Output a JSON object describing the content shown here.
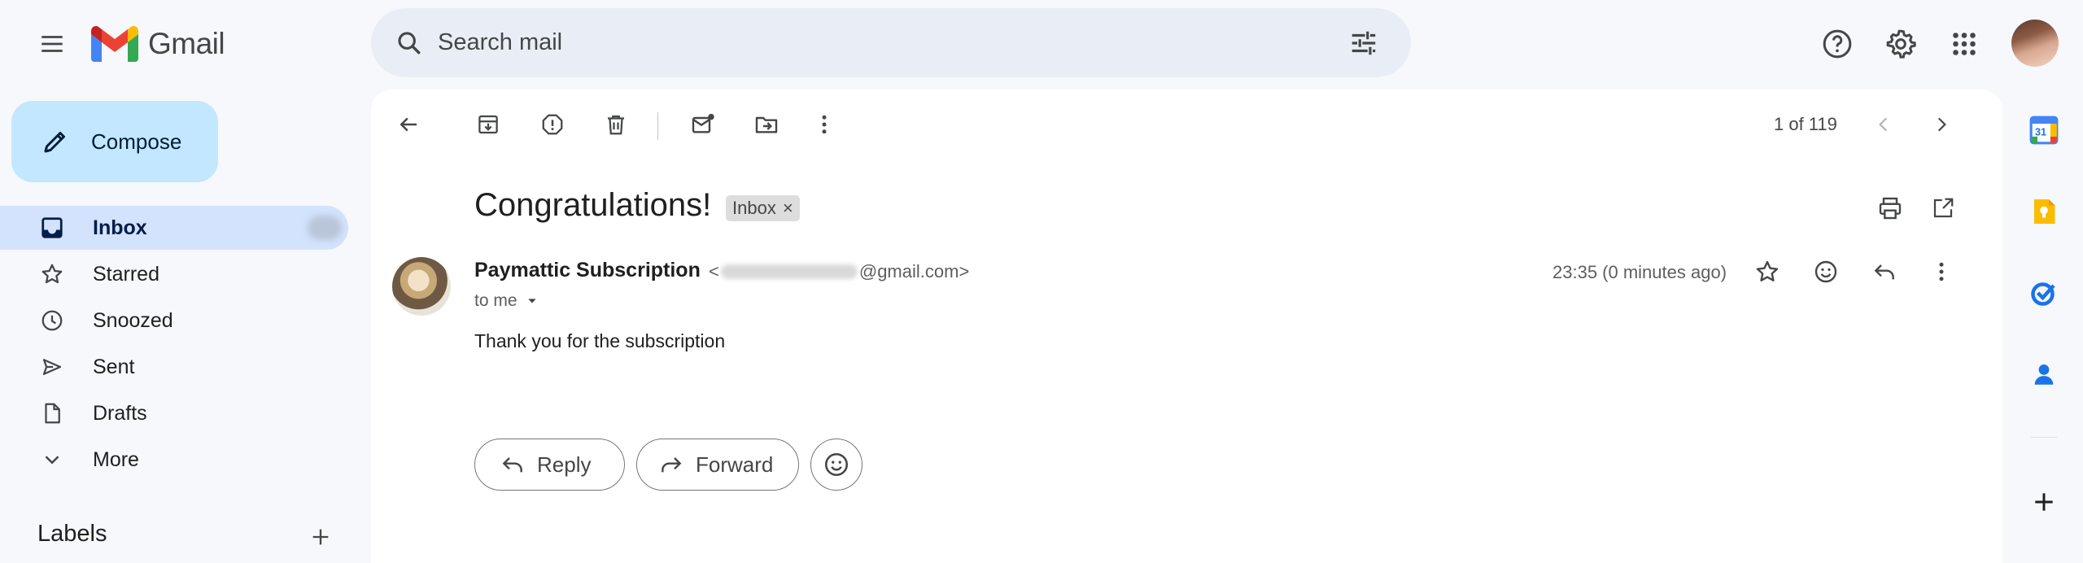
{
  "app": {
    "name": "Gmail"
  },
  "colors": {
    "accent": "#0b57d0",
    "compose_bg": "#c2e7ff",
    "active_nav": "#d3e3fd",
    "panel_bg": "#ffffff",
    "page_bg": "#f6f8fc"
  },
  "search": {
    "placeholder": "Search mail"
  },
  "sidebar": {
    "compose_label": "Compose",
    "items": [
      {
        "label": "Inbox",
        "icon": "inbox-icon",
        "active": true
      },
      {
        "label": "Starred",
        "icon": "star-icon"
      },
      {
        "label": "Snoozed",
        "icon": "clock-icon"
      },
      {
        "label": "Sent",
        "icon": "send-icon"
      },
      {
        "label": "Drafts",
        "icon": "draft-icon"
      },
      {
        "label": "More",
        "icon": "chevron-down-icon"
      }
    ],
    "labels_heading": "Labels"
  },
  "toolbar": {
    "pager": "1 of 119"
  },
  "message": {
    "subject": "Congratulations!",
    "badge": "Inbox",
    "badge_close": "×",
    "sender_name": "Paymattic Subscription",
    "sender_email_prefix": "<",
    "sender_email_suffix": "@gmail.com>",
    "to": "to me",
    "time": "23:35 (0 minutes ago)",
    "body": "Thank you for the subscription"
  },
  "actions": {
    "reply": "Reply",
    "forward": "Forward"
  },
  "side_panel": {
    "calendar_day": "31"
  }
}
